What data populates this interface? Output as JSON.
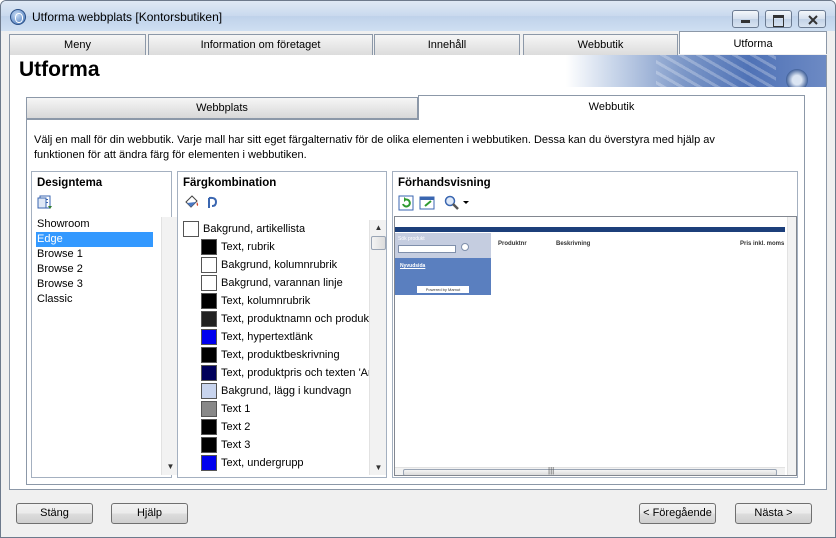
{
  "window": {
    "title": "Utforma webbplats [Kontorsbutiken]"
  },
  "tabs": [
    {
      "label": "Meny"
    },
    {
      "label": "Information om företaget"
    },
    {
      "label": "Innehåll"
    },
    {
      "label": "Webbutik"
    },
    {
      "label": "Utforma"
    }
  ],
  "header": {
    "title": "Utforma"
  },
  "subtabs": [
    {
      "label": "Webbplats"
    },
    {
      "label": "Webbutik"
    }
  ],
  "description": "Välj en mall för din webbutik. Varje mall har sitt eget färgalternativ för de olika elementen i webbutiken. Dessa kan du överstyra med hjälp av funktionen för att ändra färg för elementen i webbutiken.",
  "design": {
    "title": "Designtema",
    "items": [
      "Showroom",
      "Edge",
      "Browse 1",
      "Browse 2",
      "Browse 3",
      "Classic"
    ],
    "selected": "Edge"
  },
  "colors": {
    "title": "Färgkombination",
    "items": [
      {
        "label": "Bakgrund, artikellista",
        "color": "#ffffff"
      },
      {
        "label": "Text, rubrik",
        "color": "#000000"
      },
      {
        "label": "Bakgrund, kolumnrubrik",
        "color": "#ffffff"
      },
      {
        "label": "Bakgrund, varannan linje",
        "color": "#ffffff"
      },
      {
        "label": "Text, kolumnrubrik",
        "color": "#000000"
      },
      {
        "label": "Text, produktnamn och produkt",
        "color": "#222222"
      },
      {
        "label": "Text, hypertextlänk",
        "color": "#0000ee"
      },
      {
        "label": "Text, produktbeskrivning",
        "color": "#000000"
      },
      {
        "label": "Text, produktpris och texten 'Ar",
        "color": "#00005a"
      },
      {
        "label": "Bakgrund, lägg i kundvagn",
        "color": "#c8d4ee"
      },
      {
        "label": "Text 1",
        "color": "#888888"
      },
      {
        "label": "Text 2",
        "color": "#000000"
      },
      {
        "label": "Text 3",
        "color": "#000000"
      },
      {
        "label": "Text, undergrupp",
        "color": "#0000ee"
      }
    ]
  },
  "preview": {
    "title": "Förhandsvisning",
    "search_label": "Sök produkt",
    "link": "Nyvudsida",
    "powered": "Powered by Mamut",
    "col1": "Produktnr",
    "col2": "Beskrivning",
    "col3": "Pris inkl. moms",
    "hscroll_grip": "|||"
  },
  "buttons": {
    "close": "Stäng",
    "help": "Hjälp",
    "prev": "< Föregående",
    "next": "Nästa >"
  }
}
